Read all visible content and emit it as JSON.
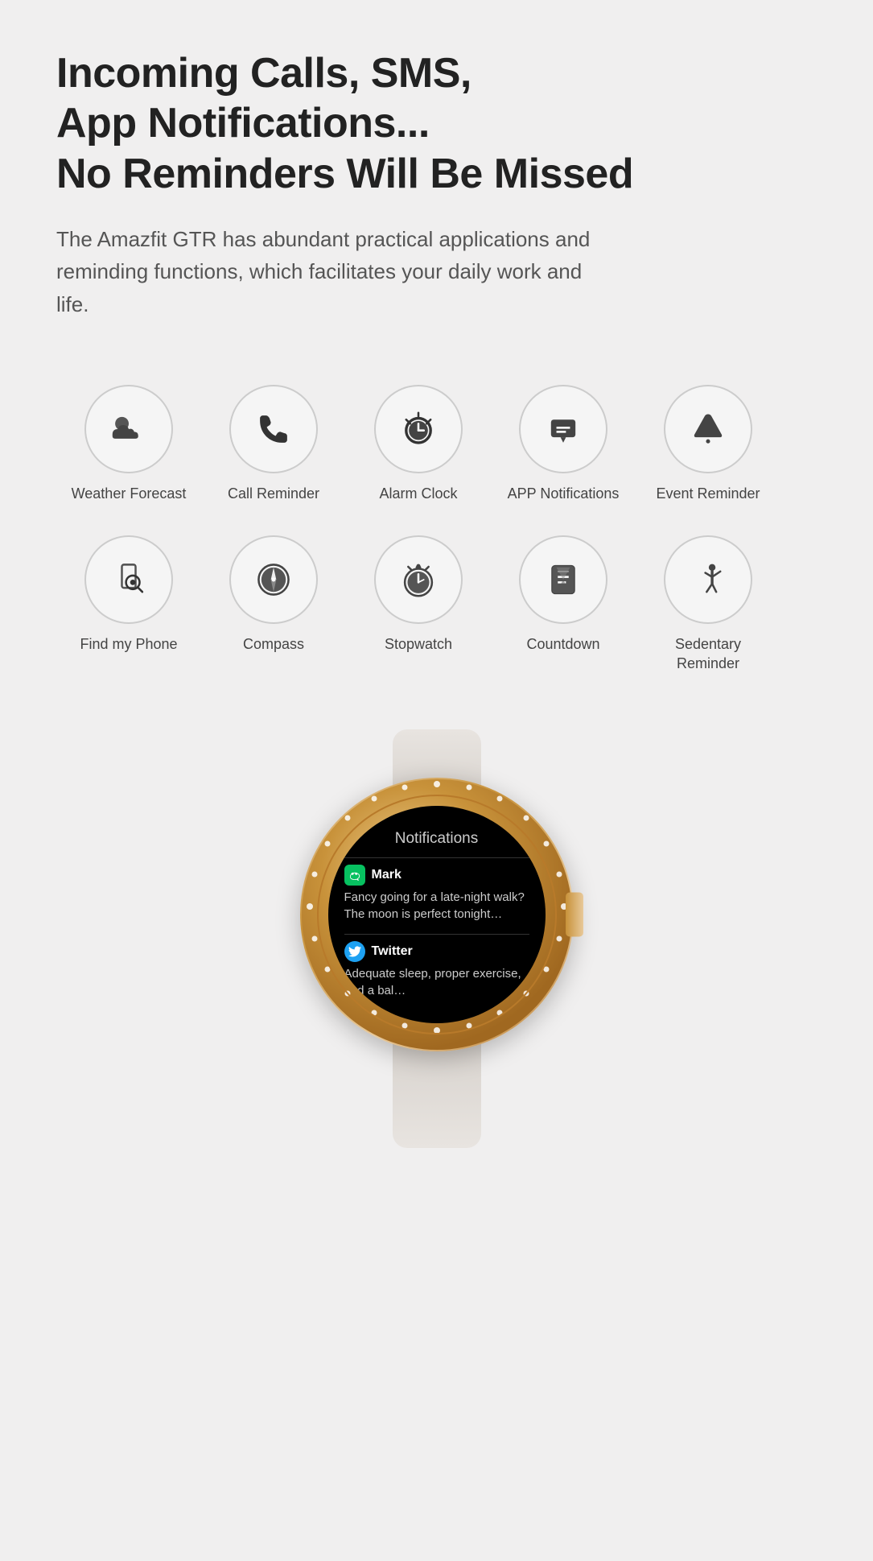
{
  "headline": {
    "line1": "Incoming Calls, SMS,",
    "line2": "App Notifications...",
    "line3": "No Reminders Will Be Missed"
  },
  "subtext": "The Amazfit GTR has abundant practical applications and reminding functions, which facilitates your daily work and life.",
  "row1": [
    {
      "id": "weather-forecast",
      "label": "Weather Forecast",
      "icon": "weather"
    },
    {
      "id": "call-reminder",
      "label": "Call Reminder",
      "icon": "call"
    },
    {
      "id": "alarm-clock",
      "label": "Alarm Clock",
      "icon": "alarm"
    },
    {
      "id": "app-notifications",
      "label": "APP Notifications",
      "icon": "notifications"
    },
    {
      "id": "event-reminder",
      "label": "Event Reminder",
      "icon": "event"
    }
  ],
  "row2": [
    {
      "id": "find-my-phone",
      "label": "Find my Phone",
      "icon": "phone-search"
    },
    {
      "id": "compass",
      "label": "Compass",
      "icon": "compass"
    },
    {
      "id": "stopwatch",
      "label": "Stopwatch",
      "icon": "stopwatch"
    },
    {
      "id": "countdown",
      "label": "Countdown",
      "icon": "countdown"
    },
    {
      "id": "sedentary-reminder",
      "label": "Sedentary Reminder",
      "icon": "sedentary"
    }
  ],
  "watch": {
    "screen_title": "Notifications",
    "notifications": [
      {
        "app": "WeChat",
        "sender": "Mark",
        "message": "Fancy going for a late-night walk? The moon is perfect tonight…"
      },
      {
        "app": "Twitter",
        "sender": "Twitter",
        "message": "Adequate sleep, proper exercise, and a bal…"
      }
    ]
  }
}
